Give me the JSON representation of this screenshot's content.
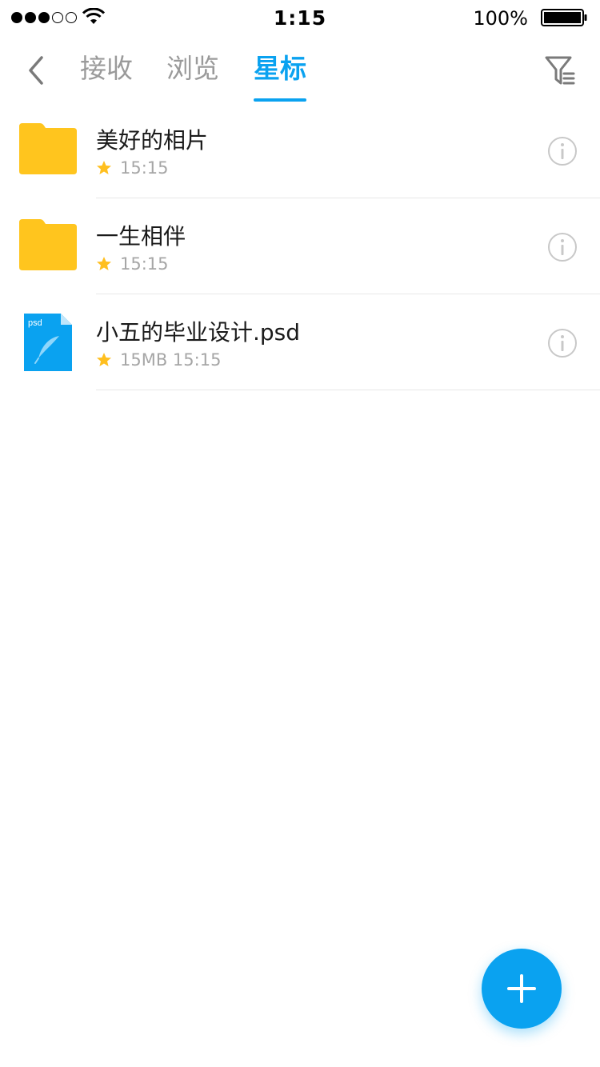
{
  "status_bar": {
    "time": "1:15",
    "battery_text": "100%",
    "signal_bars_filled": 3,
    "signal_bars_total": 5
  },
  "header": {
    "tabs": [
      {
        "label": "接收",
        "active": false
      },
      {
        "label": "浏览",
        "active": false
      },
      {
        "label": "星标",
        "active": true
      }
    ],
    "accent_color": "#0aa2f0",
    "back_icon": "chevron-left-icon",
    "filter_icon": "filter-icon"
  },
  "files": [
    {
      "name": "美好的相片",
      "type": "folder",
      "meta": "15:15",
      "starred": true
    },
    {
      "name": "一生相伴",
      "type": "folder",
      "meta": "15:15",
      "starred": true
    },
    {
      "name": "小五的毕业设计.psd",
      "type": "psd",
      "badge": "psd",
      "meta": "15MB 15:15",
      "starred": true
    }
  ],
  "colors": {
    "folder": "#ffc51e",
    "star": "#ffbf1f",
    "psd": "#0aa2f0"
  },
  "fab": {
    "icon": "plus-icon"
  }
}
